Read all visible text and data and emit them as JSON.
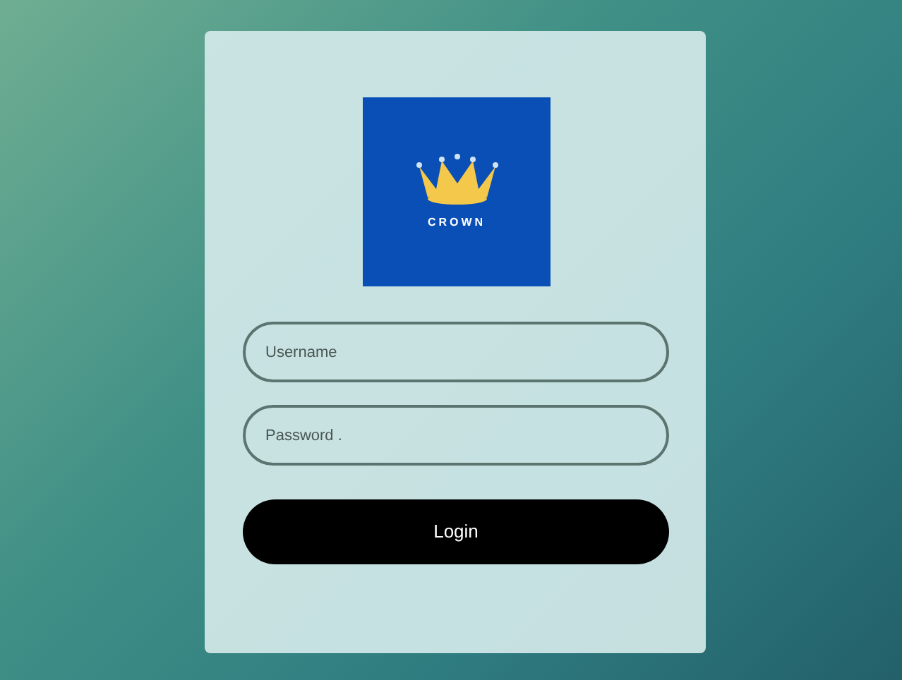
{
  "logo": {
    "text": "CROWN"
  },
  "fields": [
    {
      "placeholder": "Username"
    },
    {
      "placeholder": "Password ."
    }
  ],
  "button": {
    "label": "Login"
  }
}
